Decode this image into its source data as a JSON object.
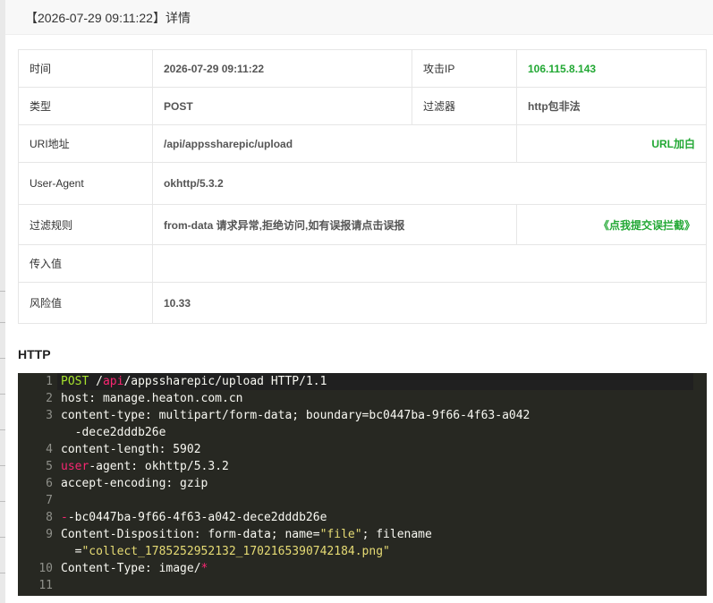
{
  "dialog": {
    "title": "【2026-07-29 09:11:22】详情"
  },
  "details": {
    "time_label": "时间",
    "time_value": "2026-07-29 09:11:22",
    "attack_ip_label": "攻击IP",
    "attack_ip_value": "106.115.8.143",
    "type_label": "类型",
    "type_value": "POST",
    "filter_label": "过滤器",
    "filter_value": "http包非法",
    "uri_label": "URI地址",
    "uri_value": "/api/appssharepic/upload",
    "url_whitelist_link": "URL加白",
    "ua_label": "User-Agent",
    "ua_value": "okhttp/5.3.2",
    "rule_label": "过滤规则",
    "rule_value": "from-data 请求异常,拒绝访问,如有误报请点击误报",
    "report_link": "《点我提交误拦截》",
    "payload_label": "传入值",
    "payload_value": "",
    "risk_label": "风险值",
    "risk_value": "10.33"
  },
  "http_section": {
    "title": "HTTP",
    "line_numbers": [
      "1",
      "2",
      "3",
      "4",
      "5",
      "6",
      "7",
      "8",
      "9",
      "10",
      "11"
    ],
    "lines": {
      "l1_method": "POST",
      "l1_sp": " /",
      "l1_api": "api",
      "l1_rest": "/appssharepic/upload HTTP/1.1",
      "l2": "host: manage.heaton.com.cn",
      "l3a": "content-type: multipart/form-data; boundary=bc0447ba-9f66-4f63-a042",
      "l3b": "  -dece2dddb26e",
      "l4": "content-length: 5902",
      "l5_key": "user",
      "l5_rest": "-agent: okhttp/5.3.2",
      "l6": "accept-encoding: gzip",
      "l7": "",
      "l8_dash": "-",
      "l8_rest": "-bc0447ba-9f66-4f63-a042-dece2dddb26e",
      "l9_a": "Content-Disposition: form-data; name=",
      "l9_name": "\"file\"",
      "l9_b": "; filename",
      "l9_c": "  =",
      "l9_file": "\"collect_1785252952132_1702165390742184.png\"",
      "l10_a": "Content-Type: image/",
      "l10_star": "*",
      "l11": ""
    }
  },
  "colors": {
    "green_accent": "#22a834",
    "code_bg": "#272822",
    "keyword": "#a6e22e",
    "operator": "#f92672",
    "string": "#e6db74"
  }
}
